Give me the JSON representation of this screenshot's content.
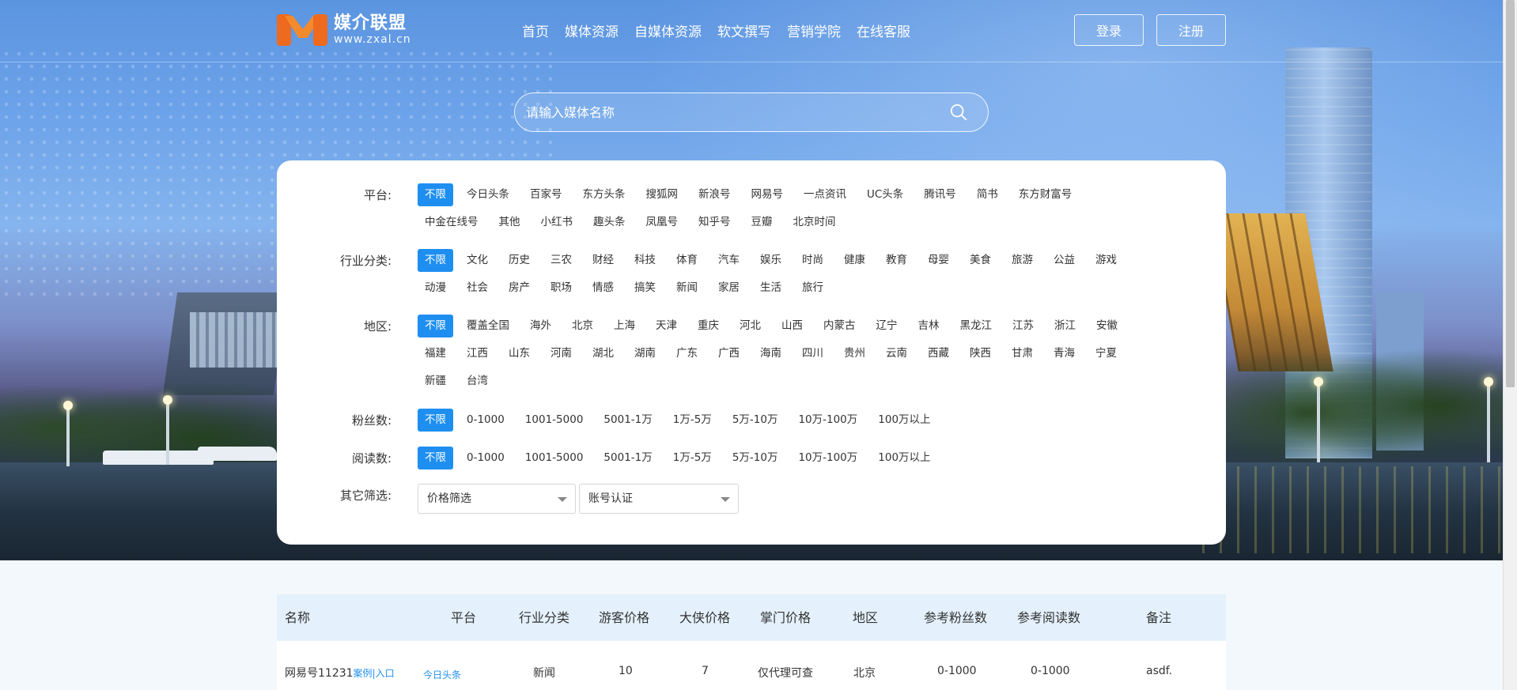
{
  "brand": {
    "name_cn": "媒介联盟",
    "domain": "www.zxal.cn"
  },
  "nav": [
    "首页",
    "媒体资源",
    "自媒体资源",
    "软文撰写",
    "营销学院",
    "在线客服"
  ],
  "auth": {
    "login": "登录",
    "register": "注册"
  },
  "search": {
    "placeholder": "请输入媒体名称",
    "value": ""
  },
  "filters": {
    "platform": {
      "label": "平台:",
      "options": [
        "不限",
        "今日头条",
        "百家号",
        "东方头条",
        "搜狐网",
        "新浪号",
        "网易号",
        "一点资讯",
        "UC头条",
        "腾讯号",
        "简书",
        "东方财富号",
        "中金在线号",
        "其他",
        "小红书",
        "趣头条",
        "凤凰号",
        "知乎号",
        "豆瓣",
        "北京时间"
      ]
    },
    "industry": {
      "label": "行业分类:",
      "options": [
        "不限",
        "文化",
        "历史",
        "三农",
        "财经",
        "科技",
        "体育",
        "汽车",
        "娱乐",
        "时尚",
        "健康",
        "教育",
        "母婴",
        "美食",
        "旅游",
        "公益",
        "游戏",
        "动漫",
        "社会",
        "房产",
        "职场",
        "情感",
        "搞笑",
        "新闻",
        "家居",
        "生活",
        "旅行"
      ]
    },
    "region": {
      "label": "地区:",
      "options": [
        "不限",
        "覆盖全国",
        "海外",
        "北京",
        "上海",
        "天津",
        "重庆",
        "河北",
        "山西",
        "内蒙古",
        "辽宁",
        "吉林",
        "黑龙江",
        "江苏",
        "浙江",
        "安徽",
        "福建",
        "江西",
        "山东",
        "河南",
        "湖北",
        "湖南",
        "广东",
        "广西",
        "海南",
        "四川",
        "贵州",
        "云南",
        "西藏",
        "陕西",
        "甘肃",
        "青海",
        "宁夏",
        "新疆",
        "台湾"
      ]
    },
    "fans": {
      "label": "粉丝数:",
      "options": [
        "不限",
        "0-1000",
        "1001-5000",
        "5001-1万",
        "1万-5万",
        "5万-10万",
        "10万-100万",
        "100万以上"
      ]
    },
    "reads": {
      "label": "阅读数:",
      "options": [
        "不限",
        "0-1000",
        "1001-5000",
        "5001-1万",
        "1万-5万",
        "5万-10万",
        "10万-100万",
        "100万以上"
      ]
    },
    "other": {
      "label": "其它筛选:",
      "price": "价格筛选",
      "account": "账号认证"
    }
  },
  "table": {
    "headers": [
      "名称",
      "平台",
      "行业分类",
      "游客价格",
      "大侠价格",
      "掌门价格",
      "地区",
      "参考粉丝数",
      "参考阅读数",
      "备注"
    ],
    "rows": [
      {
        "name": "网易号11231",
        "case": "案例",
        "entry": "|入口",
        "platform": "今日头条",
        "industry": "新闻",
        "guest_price": "10",
        "hero_price": "7",
        "master_price": "仅代理可查",
        "region": "北京",
        "fans": "0-1000",
        "reads": "0-1000",
        "note": "asdf."
      }
    ]
  },
  "colors": {
    "accent": "#1e8ff0",
    "logo": "#ee6a1f",
    "table_header": "#e4f1fc"
  }
}
